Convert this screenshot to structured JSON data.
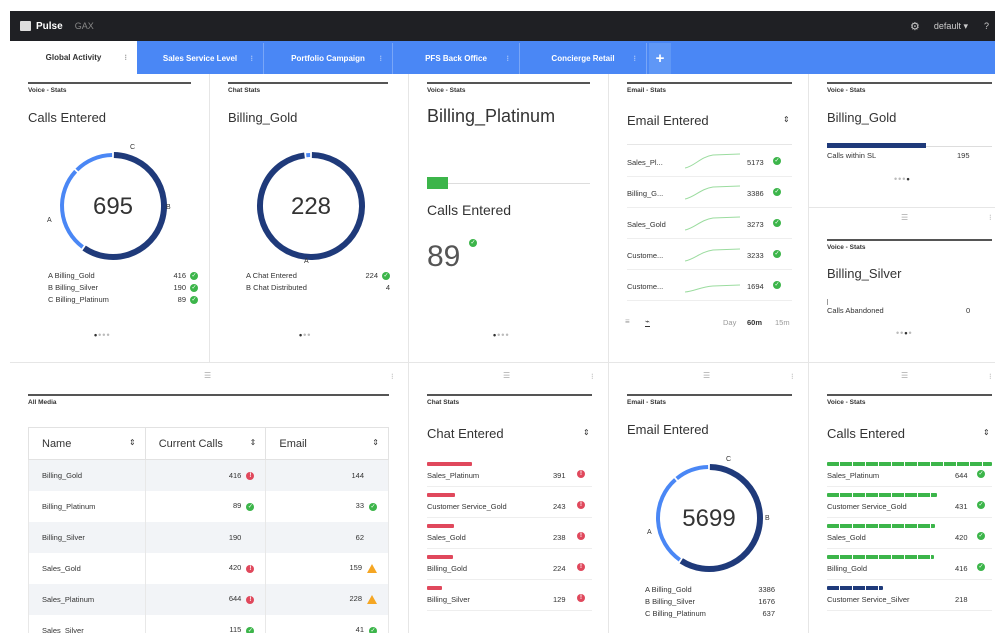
{
  "app": {
    "name": "Pulse",
    "sub": "GAX",
    "user": "default",
    "help": "?"
  },
  "tabs": [
    {
      "label": "Global Activity",
      "active": true
    },
    {
      "label": "Sales Service Level",
      "active": false
    },
    {
      "label": "Portfolio Campaign",
      "active": false
    },
    {
      "label": "PFS Back Office",
      "active": false
    },
    {
      "label": "Concierge Retail",
      "active": false
    }
  ],
  "colors": {
    "accent": "#4a87f5",
    "navy": "#1f3a7a",
    "ok": "#3cb54a",
    "bad": "#e0485c",
    "warn": "#f5a623"
  },
  "w1": {
    "type": "Voice - Stats",
    "heading": "Calls Entered",
    "total": "695",
    "labels": {
      "a": "A",
      "b": "B",
      "c": "C"
    },
    "rows": [
      {
        "label": "A Billing_Gold",
        "value": "416"
      },
      {
        "label": "B Billing_Silver",
        "value": "190"
      },
      {
        "label": "C Billing_Platinum",
        "value": "89"
      }
    ],
    "ring": [
      {
        "value": 416,
        "color": "#1f3a7a"
      },
      {
        "value": 190,
        "color": "#4a87f5"
      },
      {
        "value": 89,
        "color": "#4a87f5"
      }
    ]
  },
  "w2": {
    "type": "Chat Stats",
    "heading": "Billing_Gold",
    "total": "228",
    "labels": {
      "a": "A"
    },
    "rows": [
      {
        "label": "A Chat Entered",
        "value": "224"
      },
      {
        "label": "B Chat Distributed",
        "value": "4"
      }
    ],
    "ring": [
      {
        "value": 224,
        "color": "#1f3a7a"
      },
      {
        "value": 4,
        "color": "#4a87f5"
      }
    ]
  },
  "w3": {
    "type": "Voice - Stats",
    "heading": "Billing_Platinum",
    "sub": "Calls Entered",
    "value": "89",
    "progress": 0.13
  },
  "w4": {
    "type": "Email - Stats",
    "heading": "Email Entered",
    "rows": [
      {
        "label": "Sales_Pl...",
        "value": "5173"
      },
      {
        "label": "Billing_G...",
        "value": "3386"
      },
      {
        "label": "Sales_Gold",
        "value": "3273"
      },
      {
        "label": "Custome...",
        "value": "3233"
      },
      {
        "label": "Custome...",
        "value": "1694"
      }
    ],
    "range": {
      "day": "Day",
      "h60": "60m",
      "m15": "15m"
    }
  },
  "w5": {
    "type": "Voice - Stats",
    "heading": "Billing_Gold",
    "label": "Calls within SL",
    "value": "195",
    "progress": 0.6
  },
  "w6": {
    "type": "Voice - Stats",
    "heading": "Billing_Silver",
    "label": "Calls Abandoned",
    "value": "0"
  },
  "w7": {
    "type": "All Media",
    "columns": [
      "Name",
      "Current Calls",
      "Email"
    ],
    "rows": [
      {
        "name": "Billing_Gold",
        "calls": "416",
        "email": "144"
      },
      {
        "name": "Billing_Platinum",
        "calls": "89",
        "email": "33"
      },
      {
        "name": "Billing_Silver",
        "calls": "190",
        "email": "62"
      },
      {
        "name": "Sales_Gold",
        "calls": "420",
        "email": "159"
      },
      {
        "name": "Sales_Platinum",
        "calls": "644",
        "email": "228"
      },
      {
        "name": "Sales_Silver",
        "calls": "115",
        "email": "41"
      }
    ]
  },
  "w8": {
    "type": "Chat Stats",
    "heading": "Chat Entered",
    "rows": [
      {
        "label": "Sales_Platinum",
        "value": "391"
      },
      {
        "label": "Customer Service_Gold",
        "value": "243"
      },
      {
        "label": "Sales_Gold",
        "value": "238"
      },
      {
        "label": "Billing_Gold",
        "value": "224"
      },
      {
        "label": "Billing_Silver",
        "value": "129"
      }
    ]
  },
  "w9": {
    "type": "Email - Stats",
    "heading": "Email Entered",
    "total": "5699",
    "labels": {
      "a": "A",
      "b": "B",
      "c": "C"
    },
    "rows": [
      {
        "label": "A Billing_Gold",
        "value": "3386"
      },
      {
        "label": "B Billing_Silver",
        "value": "1676"
      },
      {
        "label": "C Billing_Platinum",
        "value": "637"
      }
    ],
    "ring": [
      {
        "value": 3386,
        "color": "#1f3a7a"
      },
      {
        "value": 1676,
        "color": "#4a87f5"
      },
      {
        "value": 637,
        "color": "#4a87f5"
      }
    ]
  },
  "w10": {
    "type": "Voice - Stats",
    "heading": "Calls Entered",
    "rows": [
      {
        "label": "Sales_Platinum",
        "value": "644"
      },
      {
        "label": "Customer Service_Gold",
        "value": "431"
      },
      {
        "label": "Sales_Gold",
        "value": "420"
      },
      {
        "label": "Billing_Gold",
        "value": "416"
      },
      {
        "label": "Customer Service_Silver",
        "value": "218"
      }
    ]
  }
}
